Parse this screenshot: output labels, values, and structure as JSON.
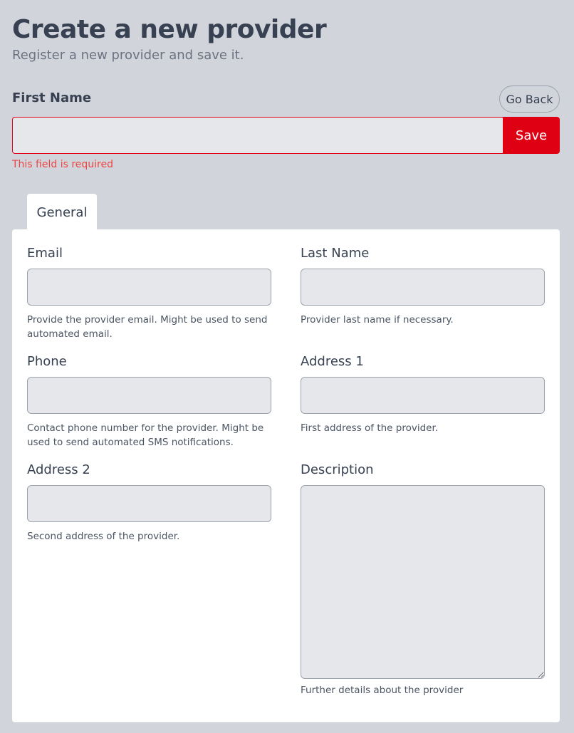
{
  "header": {
    "title": "Create a new provider",
    "subtitle": "Register a new provider and save it."
  },
  "first_name": {
    "label": "First Name",
    "value": "",
    "error": "This field is required"
  },
  "actions": {
    "go_back": "Go Back",
    "save": "Save"
  },
  "colors": {
    "accent": "#e00014",
    "background": "#d1d5db",
    "input_bg": "#e5e7eb"
  },
  "tabs": [
    {
      "label": "General",
      "active": true
    }
  ],
  "fields": {
    "email": {
      "label": "Email",
      "value": "",
      "help": "Provide the provider email. Might be used to send automated email."
    },
    "last_name": {
      "label": "Last Name",
      "value": "",
      "help": "Provider last name if necessary."
    },
    "phone": {
      "label": "Phone",
      "value": "",
      "help": "Contact phone number for the provider. Might be used to send automated SMS notifications."
    },
    "address1": {
      "label": "Address 1",
      "value": "",
      "help": "First address of the provider."
    },
    "address2": {
      "label": "Address 2",
      "value": "",
      "help": "Second address of the provider."
    },
    "description": {
      "label": "Description",
      "value": "",
      "help": "Further details about the provider"
    }
  }
}
